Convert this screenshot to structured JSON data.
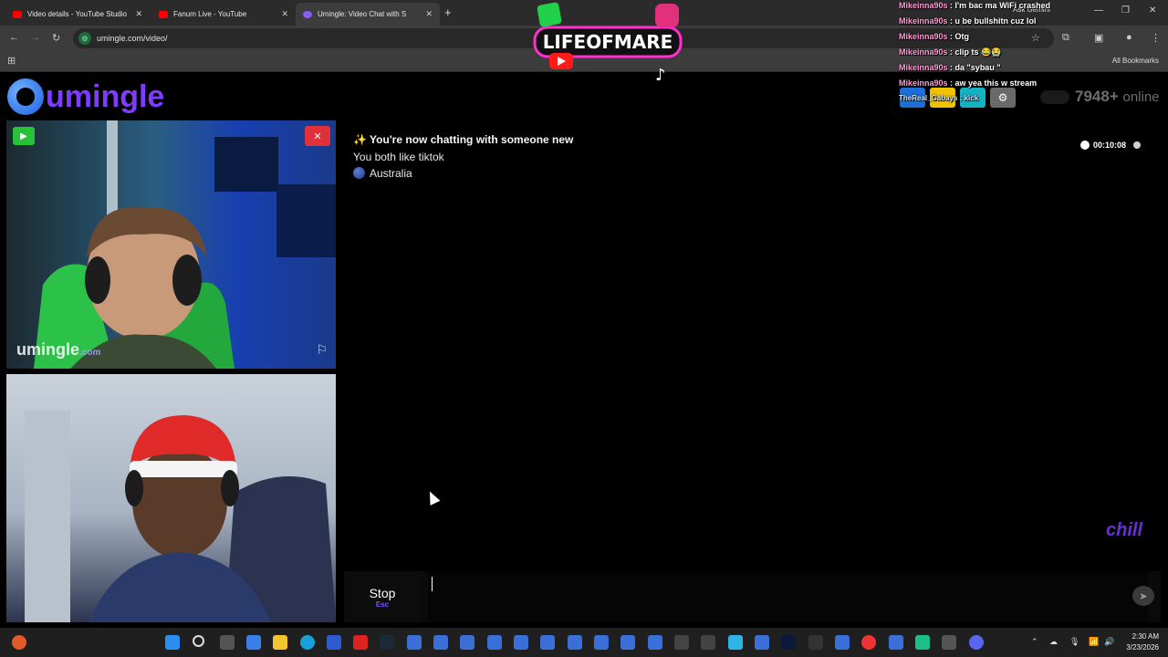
{
  "browser": {
    "tabs": [
      {
        "title": "Video details - YouTube Studio",
        "favicon_color": "#ff0000"
      },
      {
        "title": "Fanum Live - YouTube",
        "favicon_color": "#ff0000"
      },
      {
        "title": "Umingle: Video Chat with S",
        "favicon_color": "#8b5cf6"
      }
    ],
    "new_tab": "+",
    "ask_gemini": "Ask Gemini",
    "url": "umingle.com/video/",
    "all_bookmarks": "All Bookmarks"
  },
  "stream_overlay": {
    "logo_text": "LIFEOFMARE",
    "chat": [
      {
        "user": "Mikeinna90s",
        "message": "I'm bac ma WiFi crashed"
      },
      {
        "user": "Mikeinna90s",
        "message": "u be bullshitn cuz lol"
      },
      {
        "user": "Mikeinna90s",
        "message": "Otg"
      },
      {
        "user": "Mikeinna90s",
        "message": "clip ts 😂😭"
      },
      {
        "user": "Mikeinna90s",
        "message": "da \"sybau \""
      },
      {
        "user": "Mikeinna90s",
        "message": "aw yea this w stream"
      }
    ],
    "follower_alert": "TheReal_Gabays : kick"
  },
  "site": {
    "logo": "umingle",
    "online_count": "7948+",
    "online_label": "online",
    "header_button_colors": [
      "#1e6ed8",
      "#f2c200",
      "#13b3c4",
      "#6a6a6a"
    ]
  },
  "stranger_video": {
    "watermark": "umingle",
    "watermark_suffix": ".com"
  },
  "chat": {
    "system_line": "✨ You're now chatting with someone new",
    "interest_line": "You both like tiktok",
    "country": "Australia",
    "timer": "00:10:08",
    "watermark": "chill"
  },
  "controls": {
    "stop_label": "Stop",
    "stop_key": "Esc",
    "message_placeholder": ""
  },
  "taskbar": {
    "time": "2:30 AM",
    "date": "3/23/2026"
  }
}
